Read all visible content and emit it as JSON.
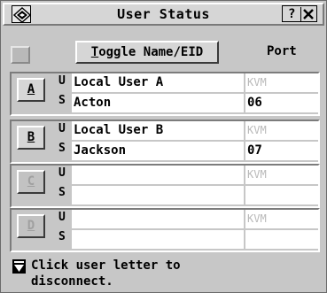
{
  "window": {
    "title": "User Status",
    "help_label": "?",
    "close_label": "X",
    "icon": "app-diamond-icon"
  },
  "header": {
    "toggle_prefix": "T",
    "toggle_rest": "oggle Name/EID",
    "port_label": "Port"
  },
  "users": [
    {
      "letter": "A",
      "user_tag": "U",
      "server_tag": "S",
      "user": "Local User A",
      "server": "Acton",
      "kvm": "KVM",
      "port": "06",
      "enabled": true
    },
    {
      "letter": "B",
      "user_tag": "U",
      "server_tag": "S",
      "user": "Local User B",
      "server": "Jackson",
      "kvm": "KVM",
      "port": "07",
      "enabled": true
    },
    {
      "letter": "C",
      "user_tag": "U",
      "server_tag": "S",
      "user": "",
      "server": "",
      "kvm": "KVM",
      "port": "",
      "enabled": false
    },
    {
      "letter": "D",
      "user_tag": "U",
      "server_tag": "S",
      "user": "",
      "server": "",
      "kvm": "KVM",
      "port": "",
      "enabled": false
    }
  ],
  "footer": {
    "line1": "Click user letter to",
    "line2": "disconnect.",
    "arrow_icon": "scroll-down-arrow-icon"
  }
}
